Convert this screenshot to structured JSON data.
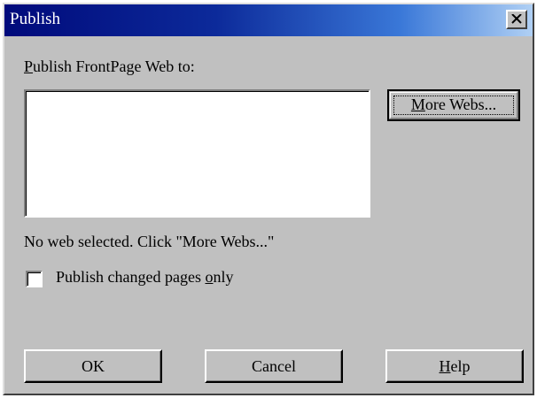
{
  "window": {
    "title": "Publish",
    "close_glyph": "×"
  },
  "publish_to": {
    "label_prefix": "P",
    "label_rest": "ublish FrontPage Web to:"
  },
  "webs_list": {
    "items": []
  },
  "more_webs_button": {
    "label_prefix": "M",
    "label_rest": "ore Webs..."
  },
  "status": {
    "text": "No web selected. Click \"More Webs...\""
  },
  "changed_only": {
    "label_before": "Publish changed pages ",
    "label_accel": "o",
    "label_after": "nly",
    "checked": false
  },
  "buttons": {
    "ok": "OK",
    "cancel": "Cancel",
    "help_prefix": "H",
    "help_rest": "elp"
  },
  "colors": {
    "dialog_face": "#c0c0c0",
    "title_gradient_start": "#000a7b",
    "title_gradient_end": "#b0d0f4",
    "title_text": "#ffffff"
  },
  "icons": {
    "close": "close-icon",
    "checkbox": "checkbox-unchecked-icon"
  }
}
